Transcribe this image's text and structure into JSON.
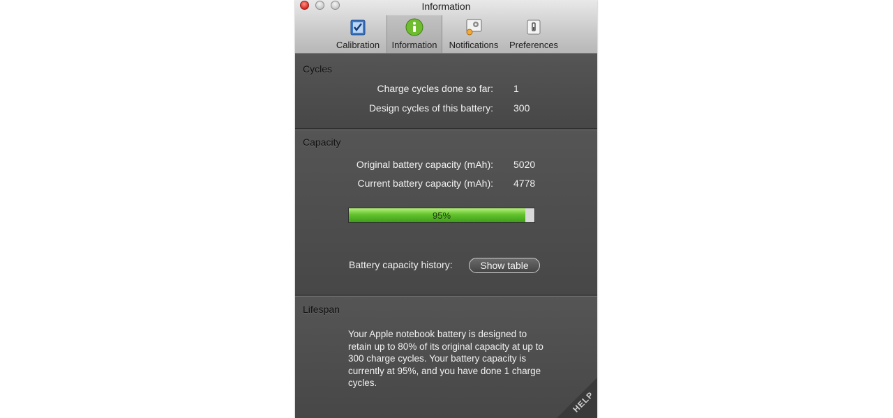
{
  "window": {
    "title": "Information"
  },
  "toolbar": {
    "tabs": [
      {
        "label": "Calibration",
        "icon": "calibration-icon"
      },
      {
        "label": "Information",
        "icon": "info-icon",
        "selected": true
      },
      {
        "label": "Notifications",
        "icon": "notifications-icon"
      },
      {
        "label": "Preferences",
        "icon": "preferences-icon"
      }
    ]
  },
  "cycles": {
    "title": "Cycles",
    "rows": [
      {
        "label": "Charge cycles done so far:",
        "value": "1"
      },
      {
        "label": "Design cycles of this battery:",
        "value": "300"
      }
    ]
  },
  "capacity": {
    "title": "Capacity",
    "rows": [
      {
        "label": "Original battery capacity (mAh):",
        "value": "5020"
      },
      {
        "label": "Current battery capacity (mAh):",
        "value": "4778"
      }
    ],
    "bar": {
      "percent": 95,
      "text": "95%"
    },
    "history_label": "Battery capacity history:",
    "show_table_label": "Show table"
  },
  "lifespan": {
    "title": "Lifespan",
    "text": "Your Apple notebook battery is designed to retain up to 80% of its original capacity at up to 300 charge cycles. Your battery capacity is currently at 95%, and you have done 1 charge cycles."
  },
  "help": {
    "label": "HELP"
  },
  "colors": {
    "bar_fill": "#62c32c",
    "background": "#4a4a4a"
  }
}
